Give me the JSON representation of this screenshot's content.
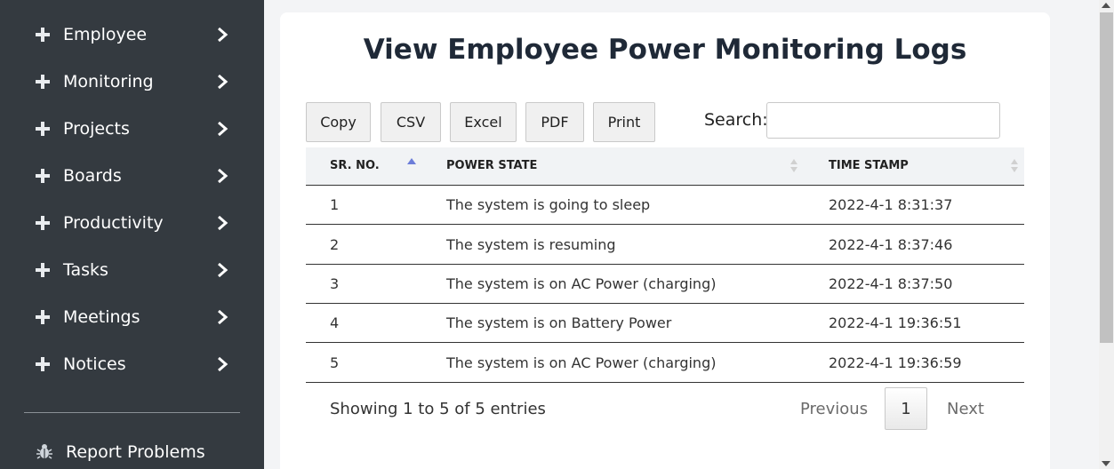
{
  "sidebar": {
    "items": [
      {
        "label": "Employee"
      },
      {
        "label": "Monitoring"
      },
      {
        "label": "Projects"
      },
      {
        "label": "Boards"
      },
      {
        "label": "Productivity"
      },
      {
        "label": "Tasks"
      },
      {
        "label": "Meetings"
      },
      {
        "label": "Notices"
      }
    ],
    "report_label": "Report Problems",
    "icons": {
      "item": "plus-icon",
      "chevron": "chevron-right-icon",
      "report": "bug-icon"
    }
  },
  "page": {
    "title": "View Employee Power Monitoring Logs"
  },
  "toolbar": {
    "copy": "Copy",
    "csv": "CSV",
    "excel": "Excel",
    "pdf": "PDF",
    "print": "Print"
  },
  "search": {
    "label": "Search:",
    "value": ""
  },
  "table": {
    "headers": [
      "SR. NO.",
      "POWER STATE",
      "TIME STAMP"
    ],
    "rows": [
      [
        "1",
        "The system is going to sleep",
        "2022-4-1 8:31:37"
      ],
      [
        "2",
        "The system is resuming",
        "2022-4-1 8:37:46"
      ],
      [
        "3",
        "The system is on AC Power (charging)",
        "2022-4-1 8:37:50"
      ],
      [
        "4",
        "The system is on Battery Power",
        "2022-4-1 19:36:51"
      ],
      [
        "5",
        "The system is on AC Power (charging)",
        "2022-4-1 19:36:59"
      ]
    ]
  },
  "footer": {
    "info": "Showing 1 to 5 of 5 entries",
    "previous": "Previous",
    "current_page": "1",
    "next": "Next"
  },
  "colors": {
    "sidebar_bg": "#343a40",
    "page_bg": "#f3f4f6",
    "sort_active": "#6c7dd9"
  }
}
